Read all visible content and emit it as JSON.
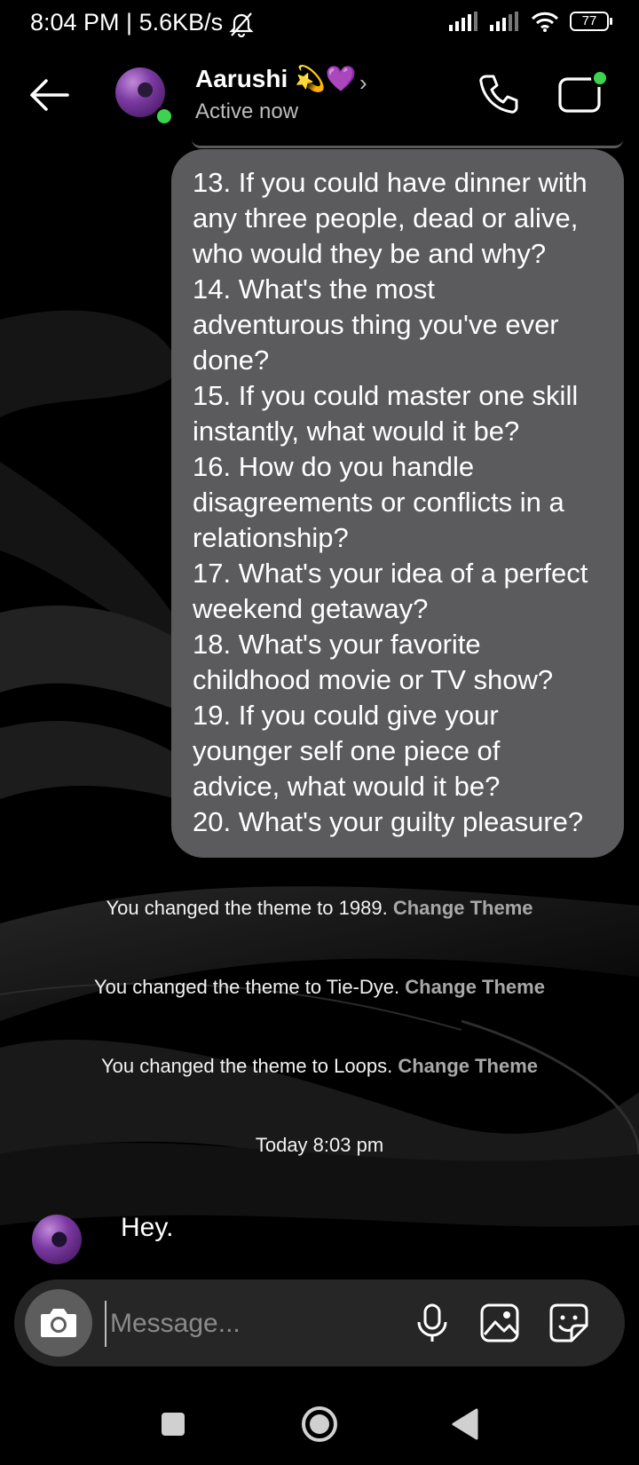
{
  "status_bar": {
    "time_speed": "8:04 PM | 5.6KB/s",
    "battery": "77"
  },
  "header": {
    "contact_name": "Aarushi",
    "contact_emoji": "💫💜",
    "chevron": "›",
    "status": "Active now"
  },
  "messages": {
    "outgoing_lines": [
      "13. If you could have dinner with",
      "any three people, dead or alive,",
      "who would they be and why?",
      "14. What's the most",
      "adventurous thing you've ever",
      "done?",
      "15. If you could master one skill",
      "instantly, what would it be?",
      "16. How do you handle",
      "disagreements or conflicts in a",
      "relationship?",
      "17. What's your idea of a perfect",
      "weekend getaway?",
      "18. What's your favorite",
      "childhood movie or TV show?",
      "19. If you could give your",
      "younger self one piece of",
      "advice, what would it be?",
      "20. What's your guilty pleasure?"
    ],
    "system": [
      {
        "text": "You changed the theme to 1989.",
        "link": "Change Theme"
      },
      {
        "text": "You changed the theme to Tie-Dye.",
        "link": "Change Theme"
      },
      {
        "text": "You changed the theme to Loops.",
        "link": "Change Theme"
      }
    ],
    "timestamp": "Today 8:03 pm",
    "incoming_text": "Hey."
  },
  "composer": {
    "placeholder": "Message..."
  },
  "icons": {
    "back": "arrow-left-icon",
    "call": "phone-icon",
    "video": "video-camera-icon",
    "camera": "camera-icon",
    "mic": "microphone-icon",
    "gallery": "image-icon",
    "sticker": "sticker-icon"
  },
  "colors": {
    "bubble": "#5b5b5e",
    "online": "#3ed34f",
    "link": "#a8a8a8"
  }
}
